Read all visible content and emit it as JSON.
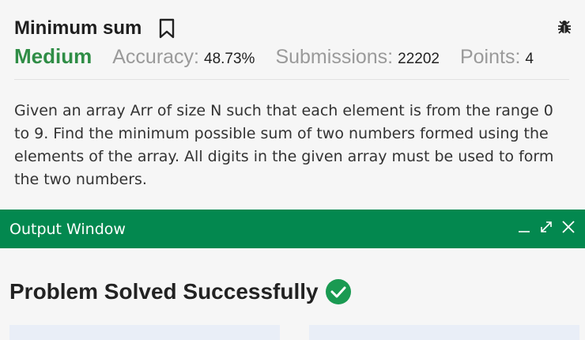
{
  "problem": {
    "title": "Minimum sum",
    "difficulty": "Medium",
    "accuracy_label": "Accuracy:",
    "accuracy_value": "48.73%",
    "submissions_label": "Submissions:",
    "submissions_value": "22202",
    "points_label": "Points:",
    "points_value": "4",
    "description": "Given an array Arr of size N such that each element is from the range 0 to 9. Find the minimum possible sum of two numbers formed using the elements of the array. All digits in the given array must be used to form the two numbers."
  },
  "output_window": {
    "title": "Output Window",
    "result": "Problem Solved Successfully"
  },
  "colors": {
    "brand_green": "#2f8d46",
    "bar_green": "#03884f",
    "success_green": "#1a9a52"
  },
  "icons": [
    "bookmark-icon",
    "bug-icon",
    "minimize-icon",
    "expand-icon",
    "close-icon",
    "check-circle-icon"
  ]
}
